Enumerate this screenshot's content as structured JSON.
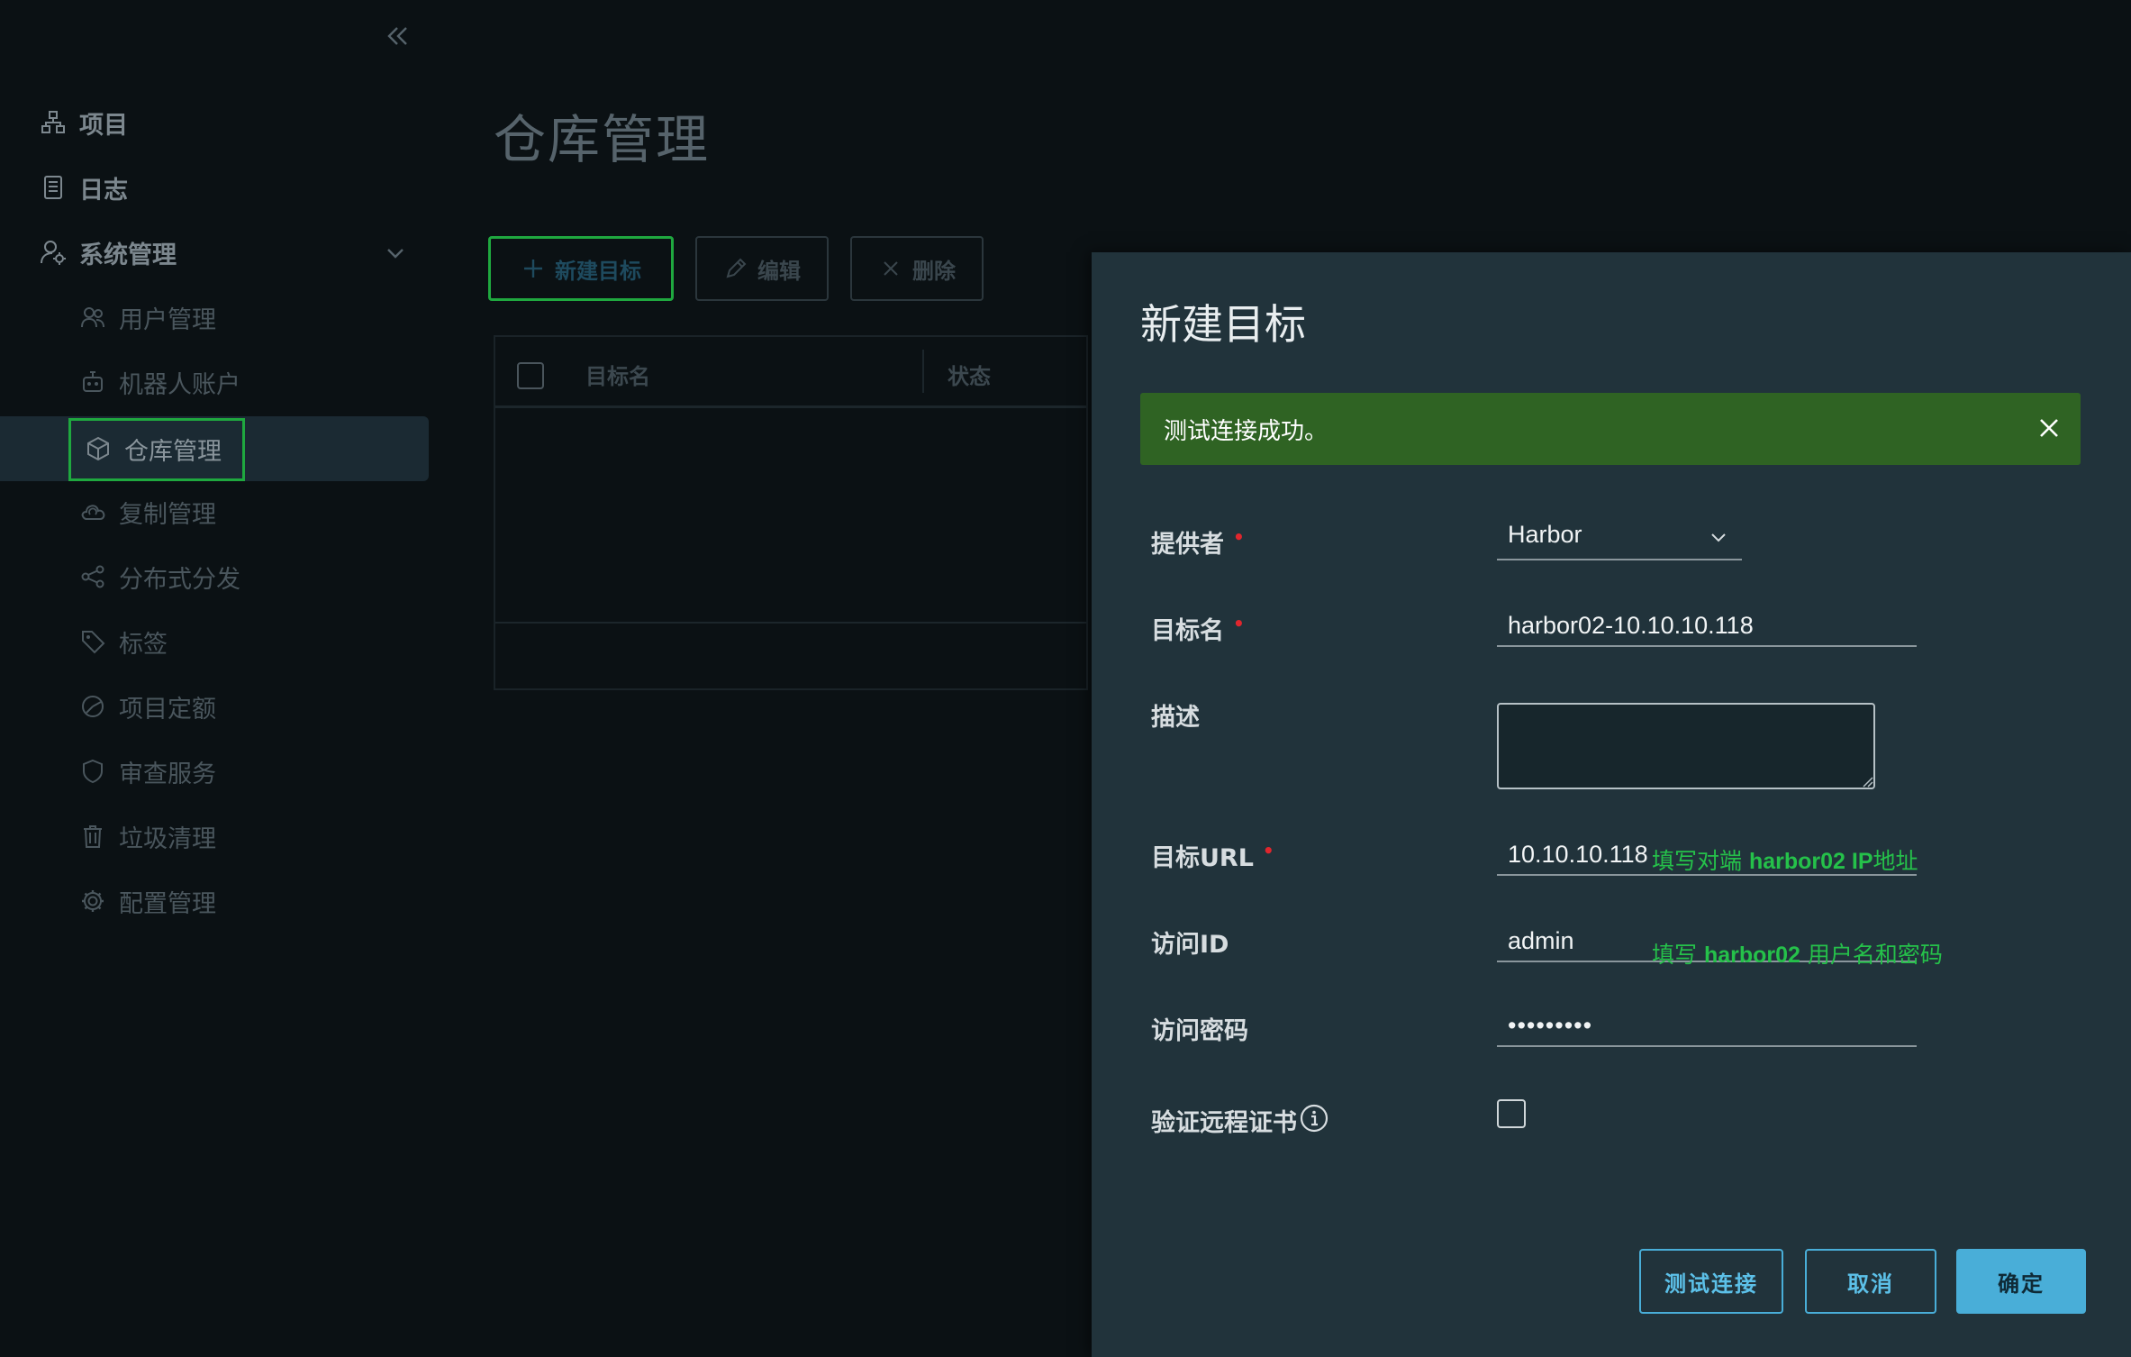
{
  "sidebar": {
    "items": [
      {
        "label": "项目",
        "icon": "project-icon"
      },
      {
        "label": "日志",
        "icon": "log-icon"
      },
      {
        "label": "系统管理",
        "icon": "admin-icon"
      }
    ],
    "sub_items": [
      {
        "label": "用户管理",
        "icon": "users-icon"
      },
      {
        "label": "机器人账户",
        "icon": "robot-icon"
      },
      {
        "label": "仓库管理",
        "icon": "cube-icon"
      },
      {
        "label": "复制管理",
        "icon": "cloud-icon"
      },
      {
        "label": "分布式分发",
        "icon": "share-icon"
      },
      {
        "label": "标签",
        "icon": "tag-icon"
      },
      {
        "label": "项目定额",
        "icon": "quota-icon"
      },
      {
        "label": "审查服务",
        "icon": "shield-icon"
      },
      {
        "label": "垃圾清理",
        "icon": "trash-icon"
      },
      {
        "label": "配置管理",
        "icon": "gear-icon"
      }
    ]
  },
  "main": {
    "title": "仓库管理",
    "toolbar": {
      "new_label": "新建目标",
      "edit_label": "编辑",
      "delete_label": "删除"
    },
    "grid": {
      "columns": [
        "目标名",
        "状态"
      ]
    }
  },
  "modal": {
    "title": "新建目标",
    "alert": "测试连接成功。",
    "fields": {
      "provider": {
        "label": "提供者",
        "value": "Harbor"
      },
      "name": {
        "label": "目标名",
        "value": "harbor02-10.10.10.118"
      },
      "description": {
        "label": "描述",
        "value": ""
      },
      "url": {
        "label": "目标URL",
        "value": "10.10.10.118"
      },
      "access_id": {
        "label": "访问ID",
        "value": "admin"
      },
      "access_secret": {
        "label": "访问密码",
        "value": "•••••••••"
      },
      "verify_cert": {
        "label": "验证远程证书"
      }
    },
    "hints": {
      "url_pre": "填写对端 ",
      "url_bold": "harbor02 IP",
      "url_post": "地址",
      "cred_pre": "填写 ",
      "cred_bold": "harbor02",
      "cred_post": " 用户名和密码"
    },
    "buttons": {
      "test": "测试连接",
      "cancel": "取消",
      "ok": "确定"
    }
  },
  "colors": {
    "accent": "#49aed8",
    "success": "#2f6323",
    "highlight": "#1fa83f",
    "annotation": "#25c14a",
    "required": "#e0262d"
  }
}
